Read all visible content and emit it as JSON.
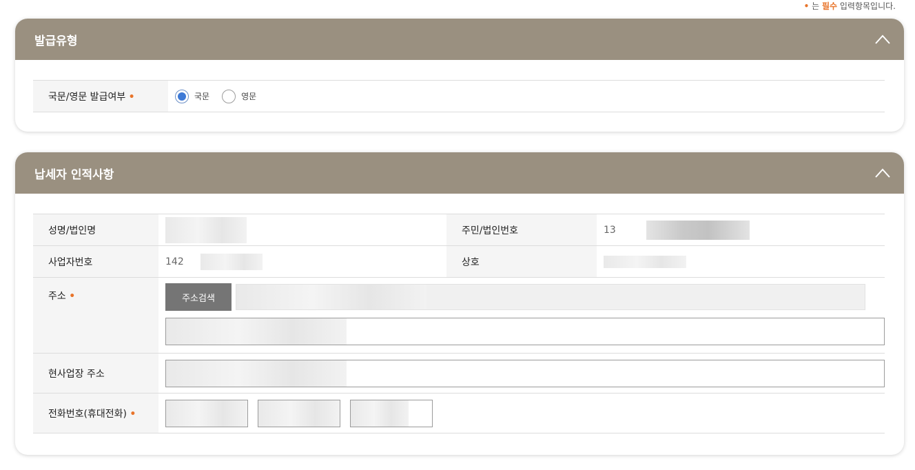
{
  "required_note": {
    "dot": "•",
    "prefix": "는",
    "highlight": "필수",
    "suffix": "입력항목입니다."
  },
  "issue_type": {
    "title": "발급유형",
    "row_label": "국문/영문 발급여부",
    "options": [
      "국문",
      "영문"
    ],
    "selected": "국문"
  },
  "taxpayer": {
    "title": "납세자 인적사항",
    "name_label": "성명/법인명",
    "id_label": "주민/법인번호",
    "id_value_prefix": "13",
    "biz_no_label": "사업자번호",
    "biz_no_value_prefix": "142",
    "company_label": "상호",
    "address_label": "주소",
    "address_search_button": "주소검색",
    "work_address_label": "현사업장 주소",
    "phone_label": "전화번호(휴대전화)"
  },
  "colors": {
    "panel_header": "#9a9080",
    "required_mark": "#e8742a",
    "radio_selected": "#3e7ad6",
    "address_button": "#757575"
  },
  "icons": {
    "collapse": "chevron-up-icon",
    "required": "required-dot-icon"
  }
}
